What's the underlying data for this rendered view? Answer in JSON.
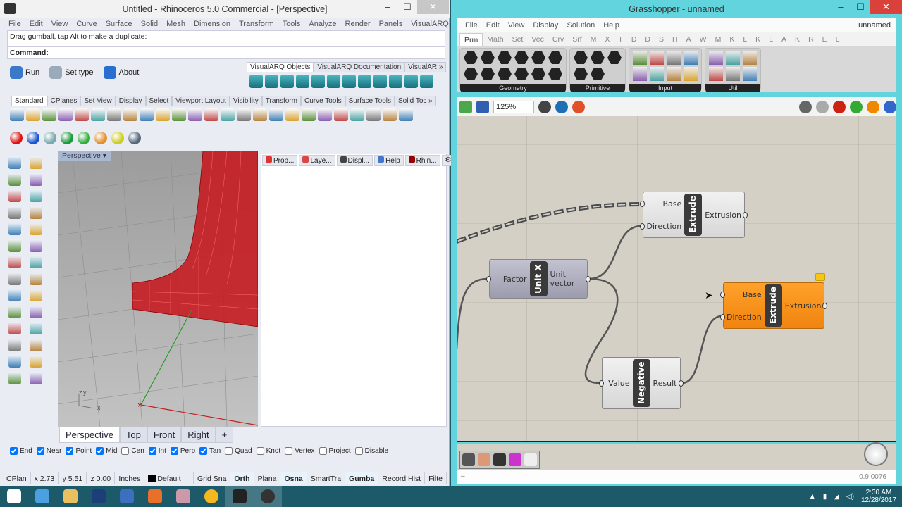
{
  "rhino": {
    "title": "Untitled - Rhinoceros 5.0 Commercial - [Perspective]",
    "window_controls": [
      "–",
      "☐",
      "✕"
    ],
    "menu": [
      "File",
      "Edit",
      "View",
      "Curve",
      "Surface",
      "Solid",
      "Mesh",
      "Dimension",
      "Transform",
      "Tools",
      "Analyze",
      "Render",
      "Panels",
      "VisualARQ",
      "Help"
    ],
    "history": "Drag gumball, tap Alt to make a duplicate:",
    "command_label": "Command:",
    "command_value": "",
    "plugin_buttons": [
      {
        "label": "Run",
        "icon": "run-icon",
        "color": "#3b78c8"
      },
      {
        "label": "Set type",
        "icon": "set-type-icon",
        "color": "#9ab"
      },
      {
        "label": "About",
        "icon": "info-icon",
        "color": "#2a6fd0"
      }
    ],
    "varq_tabs": [
      "VisualARQ Objects",
      "VisualARQ Documentation",
      "VisualAR »"
    ],
    "varq_icons": [
      "wall-icon",
      "curtain-wall-icon",
      "beam-icon",
      "column-icon",
      "door-icon",
      "window-icon",
      "opening-icon",
      "railing-icon",
      "slab-icon",
      "roof-icon",
      "furniture-icon",
      "element-icon"
    ],
    "toolbar_tabs": [
      "Standard",
      "CPlanes",
      "Set View",
      "Display",
      "Select",
      "Viewport Layout",
      "Visibility",
      "Transform",
      "Curve Tools",
      "Surface Tools",
      "Solid Toc »"
    ],
    "standard_icons": [
      "new-icon",
      "open-icon",
      "save-icon",
      "print-icon",
      "import-icon",
      "cut-icon",
      "copy-icon",
      "paste-icon",
      "undo-icon",
      "pan-icon",
      "rotate-view-icon",
      "zoom-dynamic-icon",
      "zoom-window-icon",
      "zoom-extents-icon",
      "zoom-selected-icon",
      "grid-icon",
      "car-icon",
      "select-icon",
      "camera-icon",
      "color-icon",
      "light-icon",
      "lock-icon",
      "render-icon",
      "color-wheel-icon",
      "sphere-icon"
    ],
    "solid_icons": [
      {
        "name": "red-sphere-icon",
        "color": "#d11"
      },
      {
        "name": "blue-sphere-icon",
        "color": "#1755d0"
      },
      {
        "name": "mesh-box-icon",
        "color": "#7aa"
      },
      {
        "name": "green-solid-icon",
        "color": "#1a9a3a"
      },
      {
        "name": "green-box-icon",
        "color": "#2fae3c"
      },
      {
        "name": "cone-icon",
        "color": "#e2902a"
      },
      {
        "name": "control-points-icon",
        "color": "#cc2"
      },
      {
        "name": "polysurface-icon",
        "color": "#567"
      }
    ],
    "left_tools": [
      "select-arrow-icon",
      "point-icon",
      "polyline-icon",
      "curve-icon",
      "circle-icon",
      "arc-icon",
      "polygon-icon",
      "rectangle-icon",
      "ellipse-icon",
      "fillet-icon",
      "surface-icon",
      "network-surface-icon",
      "box-icon",
      "sphere-solid-icon",
      "extrude-icon",
      "loft-icon",
      "boolean-icon",
      "trim-icon",
      "move-icon",
      "array-icon",
      "group-icon",
      "explode-icon",
      "text-icon",
      "dimension-icon",
      "block-icon",
      "properties-icon",
      "more-icon",
      "check-icon"
    ],
    "viewport": {
      "label": "Perspective",
      "axes": [
        "z",
        "y",
        "x"
      ]
    },
    "viewport_tabs": [
      "Perspective",
      "Top",
      "Front",
      "Right",
      "+"
    ],
    "panel_tabs": [
      {
        "label": "Prop...",
        "color": "#d33"
      },
      {
        "label": "Laye...",
        "color": "#d44"
      },
      {
        "label": "Displ...",
        "color": "#444"
      },
      {
        "label": "Help",
        "color": "#47c"
      },
      {
        "label": "Rhin...",
        "color": "#900"
      }
    ],
    "osnaps": [
      {
        "label": "End",
        "checked": true
      },
      {
        "label": "Near",
        "checked": true
      },
      {
        "label": "Point",
        "checked": true
      },
      {
        "label": "Mid",
        "checked": true
      },
      {
        "label": "Cen",
        "checked": false
      },
      {
        "label": "Int",
        "checked": true
      },
      {
        "label": "Perp",
        "checked": true
      },
      {
        "label": "Tan",
        "checked": true
      },
      {
        "label": "Quad",
        "checked": false
      },
      {
        "label": "Knot",
        "checked": false
      },
      {
        "label": "Vertex",
        "checked": false
      },
      {
        "label": "Project",
        "checked": false
      },
      {
        "label": "Disable",
        "checked": false
      }
    ],
    "status": {
      "cplane": "CPlan",
      "x": "x 2.73",
      "y": "y 5.51",
      "z": "z 0.00",
      "units": "Inches",
      "layer": "Default",
      "layer_color": "#000000",
      "toggles": [
        {
          "label": "Grid Sna",
          "active": false
        },
        {
          "label": "Orth",
          "active": true
        },
        {
          "label": "Plana",
          "active": false
        },
        {
          "label": "Osna",
          "active": true
        },
        {
          "label": "SmartTra",
          "active": false
        },
        {
          "label": "Gumba",
          "active": true
        },
        {
          "label": "Record Hist",
          "active": false
        },
        {
          "label": "Filte",
          "active": false
        }
      ]
    }
  },
  "gh": {
    "title": "Grasshopper - unnamed",
    "window_controls": [
      "–",
      "☐",
      "✕"
    ],
    "menu": [
      "File",
      "Edit",
      "View",
      "Display",
      "Solution",
      "Help"
    ],
    "doc_name": "unnamed",
    "tabs": [
      "Prm",
      "Math",
      "Set",
      "Vec",
      "Crv",
      "Srf",
      "M",
      "X",
      "T",
      "D",
      "D",
      "S",
      "H",
      "A",
      "W",
      "M",
      "K",
      "L",
      "K",
      "L",
      "A",
      "K",
      "R",
      "E",
      "L"
    ],
    "groups": [
      {
        "label": "Geometry",
        "icons": [
          "geometry-icon",
          "point-param-icon",
          "circle-param-icon",
          "arc-param-icon",
          "box-param-icon",
          "brep-param-icon",
          "vector-param-icon",
          "curve-param-icon",
          "line-param-icon",
          "plane-param-icon",
          "surface-param-icon",
          "mesh-param-icon"
        ],
        "style": "hex"
      },
      {
        "label": "Primitive",
        "icons": [
          "boolean-param-icon",
          "number-param-icon",
          "integer-param-icon",
          "text-param-icon",
          "generic-param-icon"
        ],
        "style": "hex"
      },
      {
        "label": "Input",
        "icons": [
          "panel-icon",
          "graph-icon",
          "toggle-icon",
          "button-icon",
          "slider-icon",
          "value-list-icon",
          "gradient-icon",
          "color-swatch-icon"
        ],
        "style": "box"
      },
      {
        "label": "Util",
        "icons": [
          "cherry-icon",
          "tree-icon",
          "arrow-icon",
          "arrow-outline-icon",
          "ball-icon",
          "flask-icon"
        ],
        "style": "box"
      }
    ],
    "toolbar": {
      "zoom": "125%",
      "icons_left": [
        "open-file-icon",
        "save-icon",
        "zoom-extents-icon",
        "preview-eye-icon",
        "sketch-icon"
      ],
      "icons_right": [
        "preview-off-icon",
        "wireframe-icon",
        "shaded-icon",
        "selected-preview-icon",
        "material-icon",
        "sphere-preview-icon"
      ]
    },
    "nodes": {
      "extrude1": {
        "title": "Extrude",
        "inputs": [
          "Base",
          "Direction"
        ],
        "outputs": [
          "Extrusion"
        ]
      },
      "unitx": {
        "title": "Unit X",
        "inputs": [
          "Factor"
        ],
        "outputs": [
          "Unit vector"
        ]
      },
      "extrude2": {
        "title": "Extrude",
        "inputs": [
          "Base",
          "Direction"
        ],
        "outputs": [
          "Extrusion"
        ],
        "state": "warning"
      },
      "negative": {
        "title": "Negative",
        "inputs": [
          "Value"
        ],
        "outputs": [
          "Result"
        ]
      }
    },
    "bottom_icons": [
      "bake-icon",
      "cluster-icon",
      "expression-icon",
      "bird-icon",
      "collapse-icon"
    ],
    "status_left": "–",
    "version": "0.9.0076"
  },
  "taskbar": {
    "icons": [
      "start-icon",
      "control-panel-icon",
      "file-explorer-icon",
      "photoshop-icon",
      "network-icon",
      "firefox-icon",
      "paint-icon",
      "chrome-canary-icon",
      "rhino-icon",
      "obs-icon"
    ],
    "time": "2:30 AM",
    "date": "12/28/2017",
    "tray": [
      "▲",
      "battery-icon",
      "signal-icon",
      "volume-icon"
    ]
  }
}
